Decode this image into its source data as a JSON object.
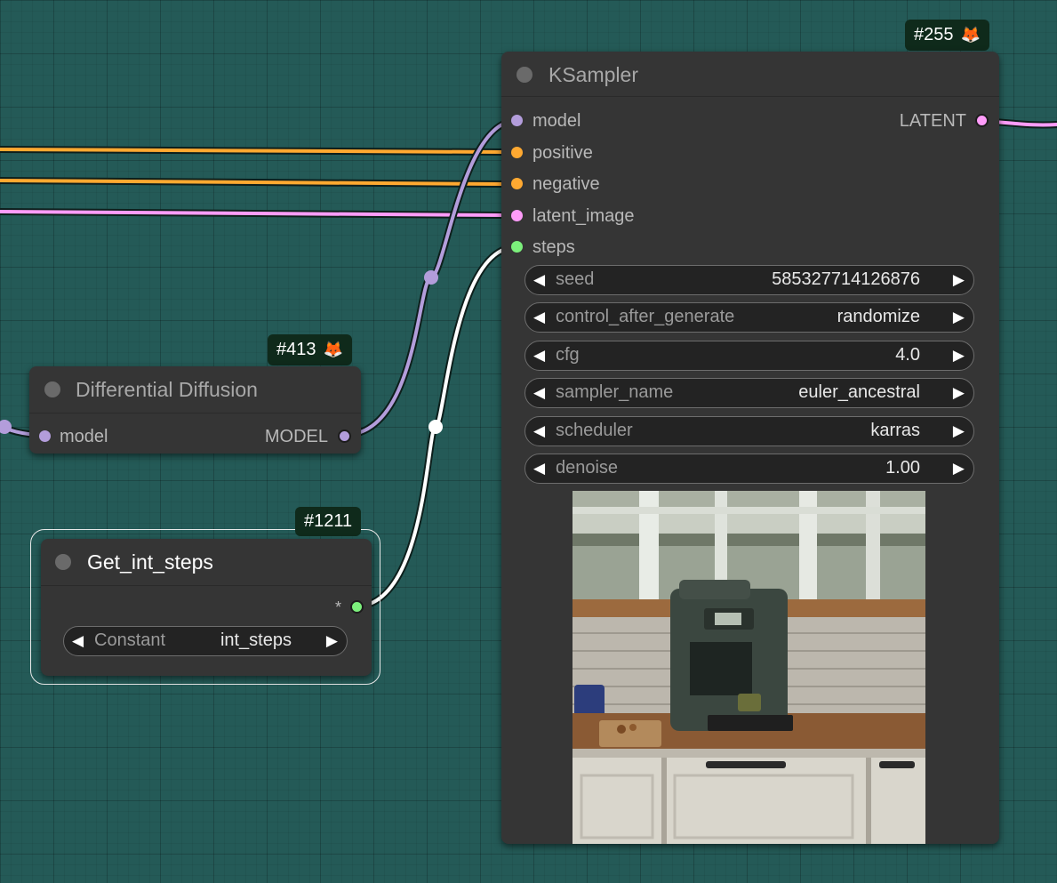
{
  "colors": {
    "canvas_bg": "#245a57",
    "node_bg": "#353535",
    "model_slot": "#b39ddb",
    "conditioning_slot": "#ffa931",
    "latent_slot": "#ff9cf9",
    "int_slot": "#7cf07c",
    "wire_white": "#ffffff",
    "badge_bg": "#0f2a1b"
  },
  "ksampler": {
    "badge": "#255",
    "badge_icon": "fox-icon",
    "title": "KSampler",
    "inputs": [
      {
        "label": "model",
        "type": "model"
      },
      {
        "label": "positive",
        "type": "conditioning"
      },
      {
        "label": "negative",
        "type": "conditioning"
      },
      {
        "label": "latent_image",
        "type": "latent"
      },
      {
        "label": "steps",
        "type": "int"
      }
    ],
    "output": {
      "label": "LATENT",
      "type": "latent"
    },
    "widgets": [
      {
        "label": "seed",
        "value": "585327714126876"
      },
      {
        "label": "control_after_generate",
        "value": "randomize"
      },
      {
        "label": "cfg",
        "value": "4.0"
      },
      {
        "label": "sampler_name",
        "value": "euler_ancestral"
      },
      {
        "label": "scheduler",
        "value": "karras"
      },
      {
        "label": "denoise",
        "value": "1.00"
      }
    ],
    "preview_image": "kitchen-coffee-machine-preview"
  },
  "differential_diffusion": {
    "badge": "#413",
    "badge_icon": "fox-icon",
    "title": "Differential Diffusion",
    "input": {
      "label": "model",
      "type": "model"
    },
    "output": {
      "label": "MODEL",
      "type": "model"
    }
  },
  "get_int_steps": {
    "badge": "#1211",
    "title": "Get_int_steps",
    "output_label": "*",
    "widget": {
      "label": "Constant",
      "value": "int_steps"
    }
  }
}
